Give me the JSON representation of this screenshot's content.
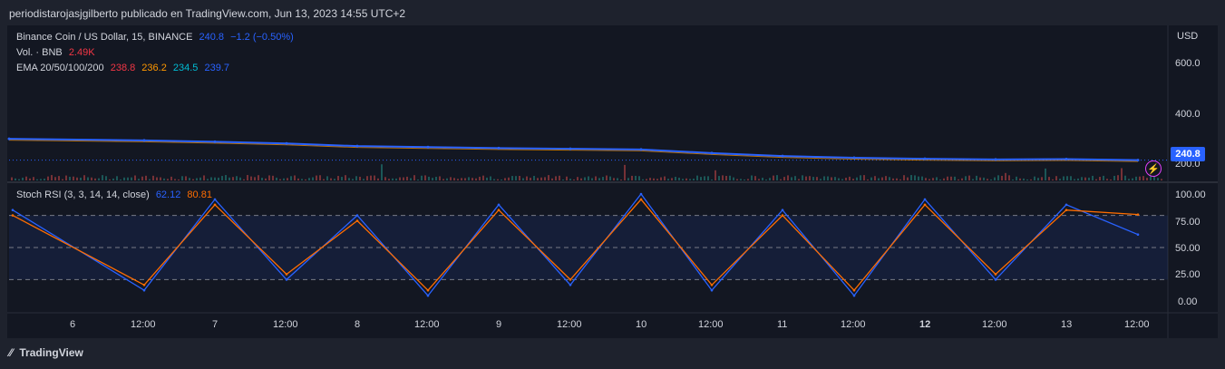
{
  "header": {
    "caption": "periodistarojasjgilberto publicado en TradingView.com, Jun 13, 2023 14:55 UTC+2"
  },
  "main_legend": {
    "symbol": "Binance Coin / US Dollar, 15, BINANCE",
    "price": "240.8",
    "change": "−1.2 (−0.50%)",
    "vol_label": "Vol. · BNB",
    "vol_value": "2.49K",
    "ema_label": "EMA 20/50/100/200",
    "ema20": "238.8",
    "ema50": "236.2",
    "ema100": "234.5",
    "ema200": "239.7"
  },
  "osc_legend": {
    "label": "Stoch RSI (3, 3, 14, 14, close)",
    "k": "62.12",
    "d": "80.81"
  },
  "price_axis": {
    "unit": "USD",
    "ticks": [
      "600.0",
      "400.0",
      "200.0"
    ],
    "last": "240.8"
  },
  "osc_axis": {
    "ticks": [
      "100.00",
      "75.00",
      "50.00",
      "25.00",
      "0.00"
    ]
  },
  "time_axis": {
    "ticks": [
      "6",
      "12:00",
      "7",
      "12:00",
      "8",
      "12:00",
      "9",
      "12:00",
      "10",
      "12:00",
      "11",
      "12:00",
      "12",
      "12:00",
      "13",
      "12:00"
    ]
  },
  "footer": {
    "brand": "TradingView"
  },
  "colors": {
    "price_line": "#2962ff",
    "k_line": "#2962ff",
    "d_line": "#ff6d00",
    "ema20": "#f23645",
    "ema50": "#ff9800",
    "ema100": "#00bcd4",
    "ema200": "#2962ff",
    "band": "#2962ff"
  },
  "chart_data": [
    {
      "type": "line",
      "title": "Binance Coin / US Dollar, 15, BINANCE",
      "ylabel": "USD",
      "ylim": [
        180,
        640
      ],
      "x": [
        "6",
        "12:00",
        "7",
        "12:00",
        "8",
        "12:00",
        "9",
        "12:00",
        "10",
        "12:00",
        "11",
        "12:00",
        "12",
        "12:00",
        "13",
        "12:00"
      ],
      "series": [
        {
          "name": "Binance Coin / US Dollar",
          "values": [
            305,
            300,
            296,
            291,
            283,
            280,
            277,
            275,
            273,
            262,
            253,
            248,
            245,
            243,
            244,
            241
          ]
        }
      ]
    },
    {
      "type": "line",
      "title": "Stoch RSI (3, 3, 14, 14, close)",
      "ylim": [
        0,
        100
      ],
      "x": [
        "6",
        "12:00",
        "7",
        "12:00",
        "8",
        "12:00",
        "9",
        "12:00",
        "10",
        "12:00",
        "11",
        "12:00",
        "12",
        "12:00",
        "13",
        "12:00"
      ],
      "series": [
        {
          "name": "K",
          "values": [
            85,
            10,
            95,
            20,
            80,
            5,
            90,
            15,
            100,
            10,
            85,
            5,
            95,
            20,
            90,
            62.12
          ]
        },
        {
          "name": "D",
          "values": [
            80,
            15,
            90,
            25,
            75,
            10,
            85,
            20,
            95,
            15,
            80,
            10,
            90,
            25,
            85,
            80.81
          ]
        }
      ]
    }
  ]
}
